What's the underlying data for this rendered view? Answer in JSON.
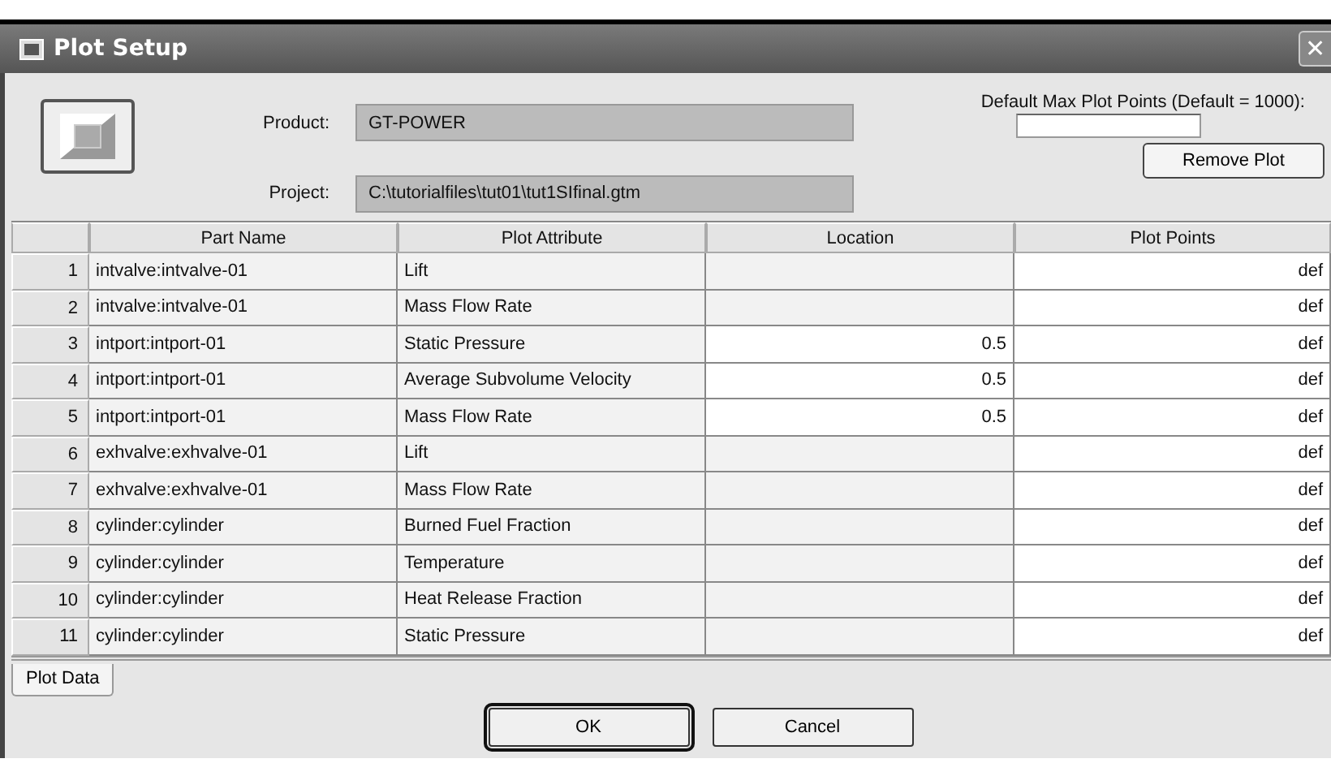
{
  "window": {
    "title": "Plot Setup",
    "close": "✕"
  },
  "header": {
    "product_label": "Product:",
    "product": "GT-POWER",
    "project_label": "Project:",
    "project": "C:\\tutorialfiles\\tut01\\tut1SIfinal.gtm",
    "max_points_label": "Default Max Plot Points (Default = 1000):",
    "remove_button": "Remove Plot"
  },
  "table": {
    "columns": [
      "Part Name",
      "Plot Attribute",
      "Location",
      "Plot Points"
    ],
    "rows": [
      {
        "number": "1",
        "part": "intvalve:intvalve-01",
        "attribute": "Lift",
        "points": "def"
      },
      {
        "number": "2",
        "part": "intvalve:intvalve-01",
        "attribute": "Mass Flow Rate",
        "points": "def"
      },
      {
        "number": "3",
        "part": "intport:intport-01",
        "attribute": "Static Pressure",
        "location": "0.5",
        "points": "def"
      },
      {
        "number": "4",
        "part": "intport:intport-01",
        "attribute": "Average Subvolume Velocity",
        "location": "0.5",
        "points": "def"
      },
      {
        "number": "5",
        "part": "intport:intport-01",
        "attribute": "Mass Flow Rate",
        "location": "0.5",
        "points": "def"
      },
      {
        "number": "6",
        "part": "exhvalve:exhvalve-01",
        "attribute": "Lift",
        "points": "def"
      },
      {
        "number": "7",
        "part": "exhvalve:exhvalve-01",
        "attribute": "Mass Flow Rate",
        "points": "def"
      },
      {
        "number": "8",
        "part": "cylinder:cylinder",
        "attribute": "Burned Fuel Fraction",
        "points": "def"
      },
      {
        "number": "9",
        "part": "cylinder:cylinder",
        "attribute": "Temperature",
        "points": "def"
      },
      {
        "number": "10",
        "part": "cylinder:cylinder",
        "attribute": "Heat Release Fraction",
        "points": "def"
      },
      {
        "number": "11",
        "part": "cylinder:cylinder",
        "attribute": "Static Pressure",
        "points": "def"
      }
    ]
  },
  "tabs": [
    {
      "label": "Plot Data",
      "selected": true
    }
  ],
  "buttons": [
    {
      "label": "OK",
      "default": true
    },
    {
      "label": "Cancel",
      "default": false
    }
  ]
}
